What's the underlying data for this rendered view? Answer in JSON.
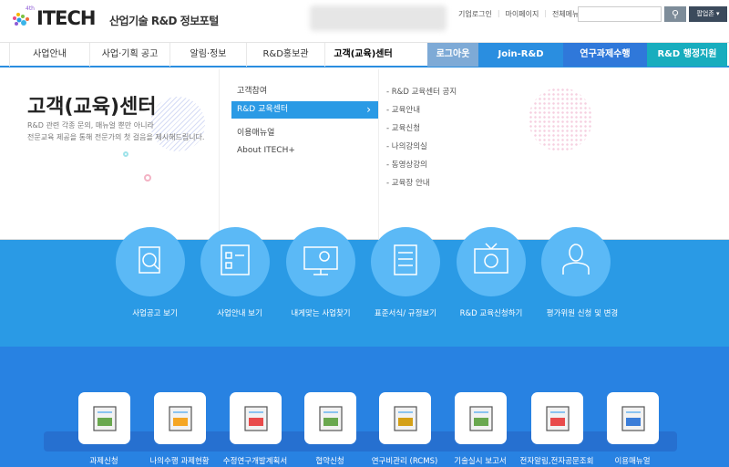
{
  "header": {
    "logo_badge": "4th",
    "logo": "ITECH",
    "logo_sub": "산업기술 R&D 정보포털",
    "links": [
      "기업로그인",
      "마이페이지",
      "전체메뉴"
    ],
    "search_placeholder": "",
    "search_icon": "search-icon",
    "popup_zone": "팝업존"
  },
  "nav": {
    "items": [
      "사업안내",
      "사업·기획 공고",
      "알림·정보",
      "R&D홍보관",
      "고객(교육)센터"
    ],
    "right": [
      {
        "label": "로그아웃",
        "color": "#7eaad6"
      },
      {
        "label": "Join-R&D",
        "color": "#2a8ee0"
      },
      {
        "label": "연구과제수행",
        "color": "#2f78da"
      },
      {
        "label": "R&D 행정지원",
        "color": "#18adbe"
      }
    ]
  },
  "dropdown": {
    "title": "고객(교육)센터",
    "desc1": "R&D 관련 각종 문의, 매뉴얼 뿐만 아니라",
    "desc2": "전문교육 제공을 통해 전문가의 첫 걸음을 제시해드립니다.",
    "menu": [
      "고객참여",
      "R&D 교육센터",
      "이용매뉴얼",
      "About ITECH+"
    ],
    "active_arrow": "›",
    "submenu": [
      "R&D 교육센터 공지",
      "교육안내",
      "교육신청",
      "나의강의실",
      "동영상강의",
      "교육장 안내"
    ]
  },
  "quick": [
    "사업공고 보기",
    "사업안내 보기",
    "내게맞는 사업찾기",
    "표준서식/ 규정보기",
    "R&D 교육신청하기",
    "평가위원 신청 및 변경"
  ],
  "services": [
    "과제신청",
    "나의수행 과제현황",
    "수정연구개발계획서",
    "협약신청",
    "연구비관리 (RCMS)",
    "기술실시 보고서",
    "전자알림,전자공문조회",
    "이용매뉴얼"
  ],
  "colors": {
    "primary": "#2a9ae5",
    "services_bg": "#2882e2"
  }
}
